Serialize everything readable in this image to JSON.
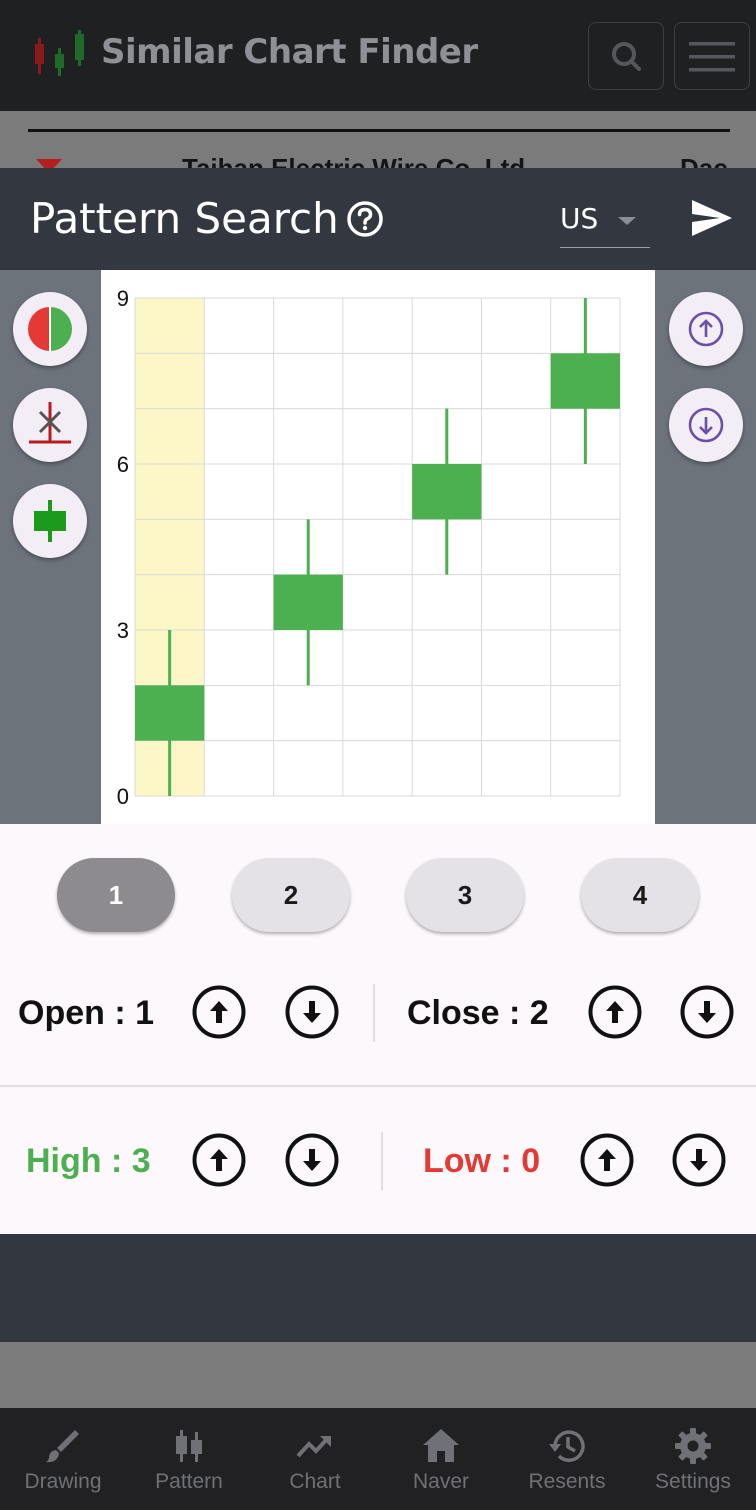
{
  "app": {
    "title": "Similar Chart Finder",
    "search_icon": "search-icon",
    "menu_icon": "hamburger-menu-icon"
  },
  "background_strip": {
    "stock_name": "Taihan Electric Wire Co.,Ltd",
    "right_text": "Dac"
  },
  "modal": {
    "title": "Pattern Search",
    "help_icon": "help-circle-icon",
    "region_value": "US",
    "send_icon": "send-icon"
  },
  "left_tools": [
    {
      "name": "color-toggle-icon"
    },
    {
      "name": "doji-candle-icon"
    },
    {
      "name": "add-candle-icon"
    }
  ],
  "right_tools": [
    {
      "name": "shift-up-icon"
    },
    {
      "name": "shift-down-icon"
    }
  ],
  "chart_data": {
    "type": "candlestick",
    "ylim": [
      0,
      9
    ],
    "y_ticks": [
      "0",
      "3",
      "6",
      "9"
    ],
    "candles": [
      {
        "index": 1,
        "open": 1,
        "close": 2,
        "high": 3,
        "low": 0
      },
      {
        "index": 2,
        "open": 3,
        "close": 4,
        "high": 5,
        "low": 2
      },
      {
        "index": 3,
        "open": 5,
        "close": 6,
        "high": 7,
        "low": 4
      },
      {
        "index": 4,
        "open": 7,
        "close": 8,
        "high": 9,
        "low": 6
      }
    ],
    "selected_index": 1,
    "colors": {
      "up": "#4caf50",
      "highlight": "#fdf7c8",
      "grid": "#d9d9d9"
    }
  },
  "tabs": [
    "1",
    "2",
    "3",
    "4"
  ],
  "values": {
    "open_label": "Open : 1",
    "close_label": "Close : 2",
    "high_label": "High : 3",
    "low_label": "Low : 0"
  },
  "colors": {
    "high": "#4caf50",
    "low": "#e53935"
  },
  "nav": [
    {
      "label": "Drawing",
      "icon": "brush-icon"
    },
    {
      "label": "Pattern",
      "icon": "candlestick-icon"
    },
    {
      "label": "Chart",
      "icon": "trending-up-icon"
    },
    {
      "label": "Naver",
      "icon": "home-icon"
    },
    {
      "label": "Resents",
      "icon": "history-icon"
    },
    {
      "label": "Settings",
      "icon": "gear-icon"
    }
  ]
}
